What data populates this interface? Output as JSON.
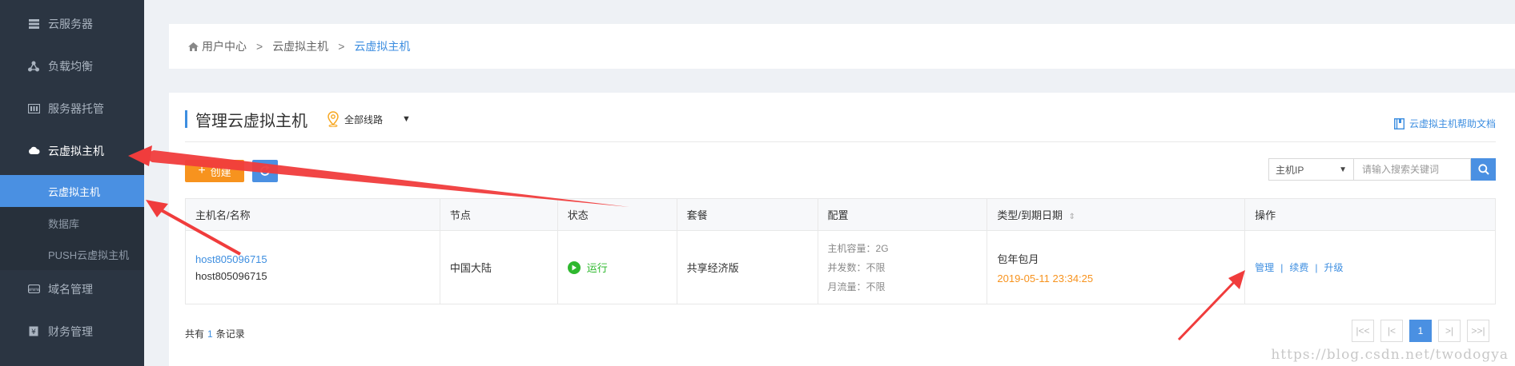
{
  "sidebar": {
    "items": [
      {
        "label": "云服务器",
        "icon": "server-list-icon"
      },
      {
        "label": "负载均衡",
        "icon": "load-balance-icon"
      },
      {
        "label": "服务器托管",
        "icon": "hosting-icon"
      },
      {
        "label": "云虚拟主机",
        "icon": "cloud-host-icon"
      }
    ],
    "subitems": [
      {
        "label": "云虚拟主机"
      },
      {
        "label": "数据库"
      },
      {
        "label": "PUSH云虚拟主机"
      }
    ],
    "bottom_items": [
      {
        "label": "域名管理",
        "icon": "domain-icon"
      },
      {
        "label": "财务管理",
        "icon": "finance-icon"
      }
    ]
  },
  "breadcrumb": {
    "home": "用户中心",
    "level1": "云虚拟主机",
    "current": "云虚拟主机",
    "separator": ">"
  },
  "main": {
    "title": "管理云虚拟主机",
    "route_filter": "全部线路",
    "help_link": "云虚拟主机帮助文档",
    "create_button": "创建",
    "search": {
      "field_selected": "主机IP",
      "placeholder": "请输入搜索关键词"
    },
    "table": {
      "headers": [
        "主机名/名称",
        "节点",
        "状态",
        "套餐",
        "配置",
        "类型/到期日期",
        "操作"
      ],
      "rows": [
        {
          "host_link": "host805096715",
          "host_name": "host805096715",
          "node": "中国大陆",
          "status": "运行",
          "plan": "共享经济版",
          "config": [
            "主机容量：2G",
            "并发数：不限",
            "月流量：不限"
          ],
          "billing_type": "包年包月",
          "expiry": "2019-05-11 23:34:25",
          "ops": [
            "管理",
            "续费",
            "升级"
          ]
        }
      ]
    },
    "total": {
      "prefix": "共有",
      "count": "1",
      "suffix": "条记录"
    },
    "pagination": {
      "first": "|<<",
      "prev": "|<",
      "current": "1",
      "next": ">|",
      "last": ">>|"
    }
  },
  "watermark": "https://blog.csdn.net/twodogya",
  "colors": {
    "sidebar_bg": "#2b3542",
    "accent_blue": "#4a90e2",
    "accent_orange": "#f7931e",
    "status_green": "#2eb82e",
    "annotation_red": "#f03c3c"
  }
}
